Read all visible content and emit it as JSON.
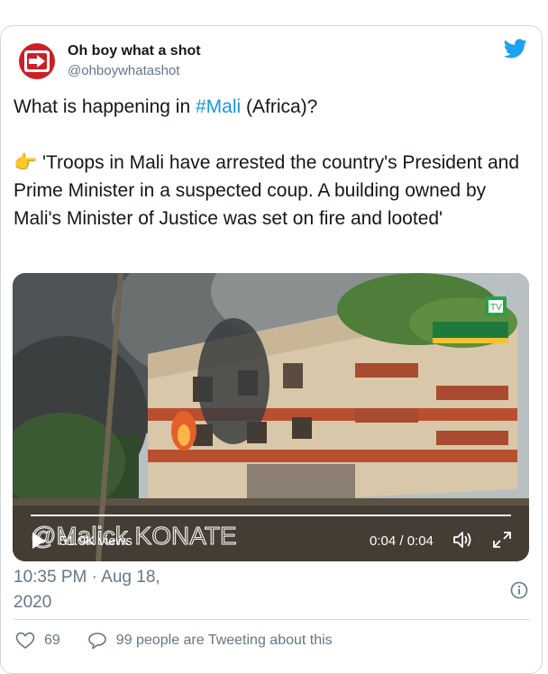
{
  "tweet": {
    "author_name": "Oh boy what a shot",
    "author_handle": "@ohboywhatashot",
    "line1_prefix": "What is happening in ",
    "hashtag": "#Mali",
    "line1_suffix": " (Africa)?",
    "emoji": "👉",
    "quote": " 'Troops in Mali have arrested the country's President  and Prime Minister in a suspected coup. A building owned by Mali's Minister of Justice was set on fire and looted'",
    "timestamp": "10:35 PM · Aug 18, 2020",
    "likes": "69",
    "tweeting_text": "99 people are Tweeting about this"
  },
  "media": {
    "watermark": "@Malick KONATE",
    "views": "51.9K views",
    "time": "0:04 / 0:04"
  },
  "icons": {
    "avatar": "arrow-right-icon",
    "brand": "twitter-bird-icon",
    "play": "play-icon",
    "volume": "volume-icon",
    "fullscreen": "fullscreen-icon",
    "info": "info-icon",
    "like": "heart-icon",
    "reply": "speech-bubble-icon"
  },
  "colors": {
    "link": "#1b95e0",
    "secondary_text": "#657786",
    "avatar_bg": "#cc1f26",
    "brand": "#1da1f2"
  }
}
